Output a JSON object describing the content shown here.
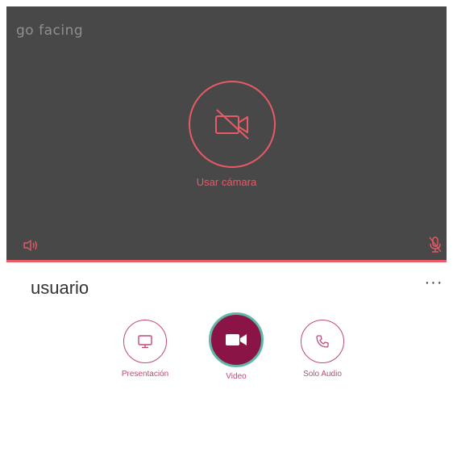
{
  "brand": {
    "text": "go facing"
  },
  "video": {
    "camera_label": "Usar cámara",
    "icons": {
      "camera": "video-off-icon",
      "speaker": "speaker-icon",
      "mic": "mic-off-icon"
    }
  },
  "user": {
    "name": "usuario",
    "more_label": "···"
  },
  "modes": [
    {
      "label": "Presentación",
      "icon": "monitor-icon",
      "active": false
    },
    {
      "label": "Video",
      "icon": "video-camera-icon",
      "active": true
    },
    {
      "label": "Solo Audio",
      "icon": "phone-icon",
      "active": false
    }
  ],
  "colors": {
    "accent": "#e85a66",
    "mode_accent": "#c2477a",
    "active_fill": "#8a1446",
    "active_ring": "#5fb8a6",
    "panel_bg": "#484848"
  }
}
